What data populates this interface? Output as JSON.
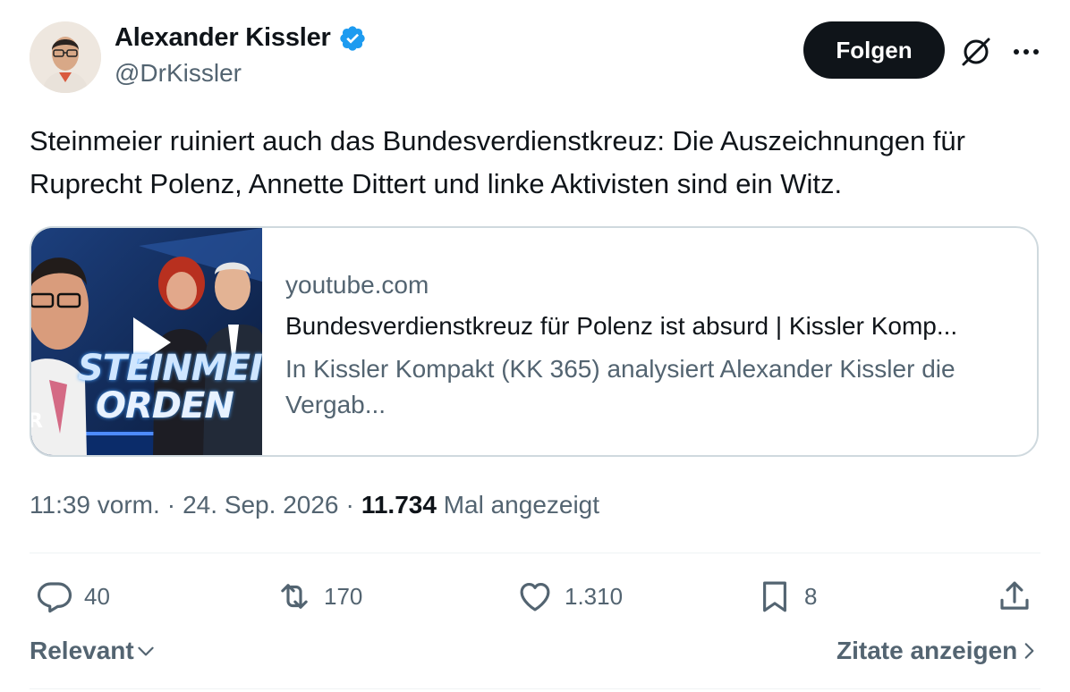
{
  "author": {
    "name": "Alexander Kissler",
    "handle": "@DrKissler",
    "verified": true,
    "verified_color": "#1d9bf0"
  },
  "follow_button": {
    "label": "Folgen"
  },
  "icons": {
    "grok": "grok-slash-icon",
    "more": "more-dots-icon"
  },
  "tweet": {
    "text": "Steinmeier ruiniert auch das Bundesverdienstkreuz: Die Auszeichnungen für Ruprecht Polenz, Annette Dittert und linke Aktivisten sind ein Witz."
  },
  "link_card": {
    "domain": "youtube.com",
    "title": "Bundesverdienstkreuz für Polenz ist absurd | Kissler Komp...",
    "description": "In Kissler Kompakt (KK 365) analysiert Alexander Kissler die Vergab...",
    "thumbnail_text_line1": "STEINMEI",
    "thumbnail_text_line2": "ORDEN",
    "thumbnail_edge_letter": "R"
  },
  "meta": {
    "time": "11:39 vorm.",
    "separator": "·",
    "date": "24. Sep. 2026",
    "views": "11.734",
    "views_label": "Mal angezeigt"
  },
  "actions": {
    "replies": "40",
    "reposts": "170",
    "likes": "1.310",
    "bookmarks": "8"
  },
  "footer": {
    "sort_label": "Relevant",
    "quotes_link": "Zitate anzeigen"
  }
}
